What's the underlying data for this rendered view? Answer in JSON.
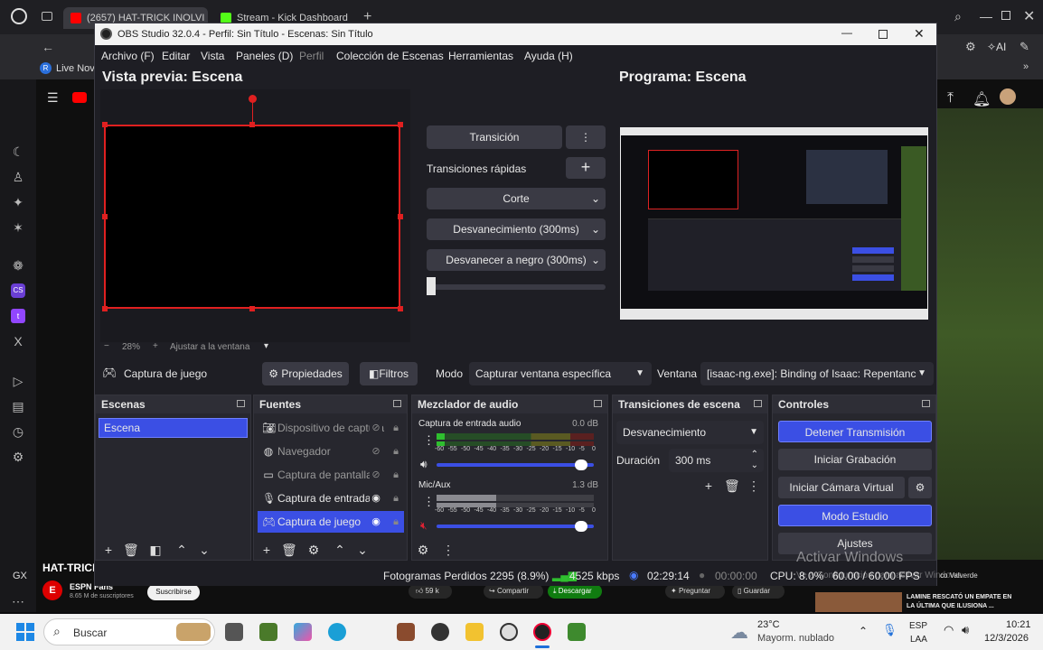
{
  "browser": {
    "tabs": [
      {
        "label": "(2657) HAT-TRICK INOLVI",
        "color": "#ff0000"
      },
      {
        "label": "Stream - Kick Dashboard",
        "color": "#53fc18"
      }
    ],
    "bookmark_label": "Live Nov",
    "yt_channel": "ESPN Fans",
    "yt_subs": "8.65 M de suscriptores",
    "yt_subscribe": "Suscribirse",
    "yt_video_title": "HAT-TRICK",
    "yt_likes": "59 k",
    "yt_share": "Compartir",
    "yt_download": "Descargar",
    "yt_ask": "Preguntar",
    "yt_save": "Guardar",
    "yt_rec_title": "LAMINE RESCATÓ UN EMPATE EN LA ÚLTIMA QUE ILUSIONA ...",
    "yt_rec_author": "co Valverde",
    "yt_gx": "GX",
    "watermark_1": "Activar Windows",
    "watermark_2": "Ve a Configuración para activar Windows."
  },
  "obs": {
    "window_title": "OBS Studio 32.0.4 - Perfil: Sin Título - Escenas: Sin Título",
    "menu": [
      "Archivo (F)",
      "Editar",
      "Vista",
      "Paneles (D)",
      "Perfil",
      "Colección de Escenas",
      "Herramientas",
      "Ayuda (H)"
    ],
    "preview_title": "Vista previa: Escena",
    "program_title": "Programa: Escena",
    "zoom": "28%",
    "fit": "Ajustar a la ventana",
    "transition_btn": "Transición",
    "quick_transitions": "Transiciones rápidas",
    "quick": [
      "Corte",
      "Desvanecimiento (300ms)",
      "Desvanecer a negro (300ms)"
    ],
    "source_bar": {
      "selected": "Captura de juego",
      "properties": "Propiedades",
      "filters": "Filtros",
      "mode_label": "Modo",
      "mode_value": "Capturar ventana específica",
      "window_label": "Ventana",
      "window_value": "[isaac-ng.exe]: Binding of Isaac: Repentanc"
    },
    "scenes": {
      "title": "Escenas",
      "items": [
        "Escena"
      ]
    },
    "sources": {
      "title": "Fuentes",
      "items": [
        {
          "label": "Dispositivo de captura",
          "icon": "camera-icon",
          "visible": false
        },
        {
          "label": "Navegador",
          "icon": "globe-icon",
          "visible": false
        },
        {
          "label": "Captura de pantalla",
          "icon": "monitor-icon",
          "visible": false
        },
        {
          "label": "Captura de entrada",
          "icon": "mic-icon",
          "visible": true
        },
        {
          "label": "Captura de juego",
          "icon": "gamepad-icon",
          "visible": true
        }
      ]
    },
    "mixer": {
      "title": "Mezclador de audio",
      "channels": [
        {
          "name": "Captura de entrada audio",
          "db": "0.0 dB",
          "level": 0.05,
          "volume": 0.96,
          "muted": false
        },
        {
          "name": "Mic/Aux",
          "db": "1.3 dB",
          "level": 0.38,
          "volume": 0.96,
          "muted": true
        }
      ],
      "ticks": [
        "-60",
        "-55",
        "-50",
        "-45",
        "-40",
        "-35",
        "-30",
        "-25",
        "-20",
        "-15",
        "-10",
        "-5",
        "0"
      ]
    },
    "transitions": {
      "title": "Transiciones de escena",
      "selected": "Desvanecimiento",
      "duration_label": "Duración",
      "duration_value": "300 ms"
    },
    "controls": {
      "title": "Controles",
      "stop_stream": "Detener Transmisión",
      "start_record": "Iniciar Grabación",
      "virtual_cam": "Iniciar Cámara Virtual",
      "studio_mode": "Modo Estudio",
      "settings": "Ajustes"
    },
    "status": {
      "dropped": "Fotogramas Perdidos 2295 (8.9%)",
      "bitrate": "4525 kbps",
      "stream_time": "02:29:14",
      "rec_time": "00:00:00",
      "cpu": "CPU: 8.0%",
      "fps": "60.00 / 60.00 FPS"
    },
    "accent": "#3b4fe4",
    "preview_border": "#e02020"
  },
  "taskbar": {
    "search": "Buscar",
    "weather_temp": "23°C",
    "weather_desc": "Mayorm. nublado",
    "lang1": "ESP",
    "lang2": "LAA",
    "time": "10:21",
    "date": "12/3/2026"
  }
}
